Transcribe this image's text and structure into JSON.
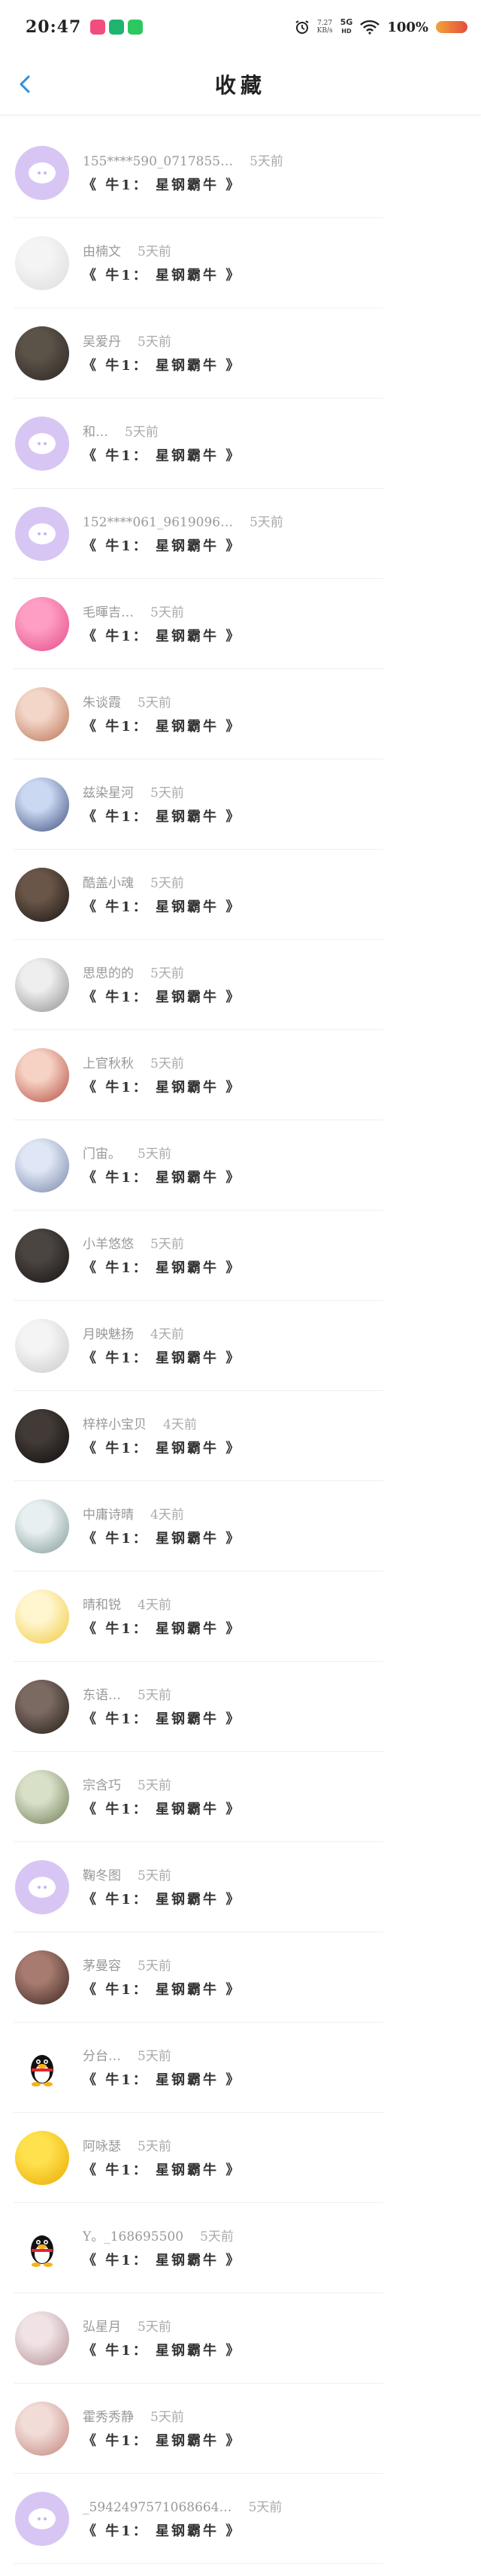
{
  "status_bar": {
    "time": "20:47",
    "net_speed_value": "7.27",
    "net_speed_unit": "KB/s",
    "signal_label": "5G",
    "signal_sub": "HD",
    "battery": "100%"
  },
  "header": {
    "title": "收藏"
  },
  "favorites": [
    {
      "name": "155****590_0717855…",
      "time": "5天前",
      "title": "《 牛1： 星钢霸牛 》",
      "avatar": "default"
    },
    {
      "name": "由楠文",
      "time": "5天前",
      "title": "《 牛1： 星钢霸牛 》",
      "avatar": "photo",
      "colors": [
        "#f4f4f4",
        "#dcdcdc"
      ]
    },
    {
      "name": "吴爱丹",
      "time": "5天前",
      "title": "《 牛1： 星钢霸牛 》",
      "avatar": "photo",
      "colors": [
        "#5b5248",
        "#2c2622"
      ]
    },
    {
      "name": "和…",
      "time": "5天前",
      "title": "《 牛1： 星钢霸牛 》",
      "avatar": "default"
    },
    {
      "name": "152****061_9619096…",
      "time": "5天前",
      "title": "《 牛1： 星钢霸牛 》",
      "avatar": "default"
    },
    {
      "name": "毛暉吉…",
      "time": "5天前",
      "title": "《 牛1： 星钢霸牛 》",
      "avatar": "photo",
      "colors": [
        "#ff9ec4",
        "#e24a88"
      ]
    },
    {
      "name": "朱谈霞",
      "time": "5天前",
      "title": "《 牛1： 星钢霸牛 》",
      "avatar": "photo",
      "colors": [
        "#f3d6c8",
        "#b8704f"
      ]
    },
    {
      "name": "兹染星河",
      "time": "5天前",
      "title": "《 牛1： 星钢霸牛 》",
      "avatar": "photo",
      "colors": [
        "#cbd8f2",
        "#3c4e7c"
      ]
    },
    {
      "name": "酷盖小魂",
      "time": "5天前",
      "title": "《 牛1： 星钢霸牛 》",
      "avatar": "photo",
      "colors": [
        "#6a5648",
        "#181412"
      ]
    },
    {
      "name": "思思的的",
      "time": "5天前",
      "title": "《 牛1： 星钢霸牛 》",
      "avatar": "photo",
      "colors": [
        "#eeeeee",
        "#8d8d8d"
      ]
    },
    {
      "name": "上官秋秋",
      "time": "5天前",
      "title": "《 牛1： 星钢霸牛 》",
      "avatar": "photo",
      "colors": [
        "#f6d2c4",
        "#b34b3e"
      ]
    },
    {
      "name": "门宙。",
      "time": "5天前",
      "title": "《 牛1： 星钢霸牛 》",
      "avatar": "photo",
      "colors": [
        "#dfe6f5",
        "#7585a8"
      ]
    },
    {
      "name": "小羊悠悠",
      "time": "5天前",
      "title": "《 牛1： 星钢霸牛 》",
      "avatar": "photo",
      "colors": [
        "#4b4542",
        "#16120f"
      ]
    },
    {
      "name": "月映魅扬",
      "time": "4天前",
      "title": "《 牛1： 星钢霸牛 》",
      "avatar": "photo",
      "colors": [
        "#f4f4f4",
        "#c9c9c9"
      ]
    },
    {
      "name": "梓梓小宝贝",
      "time": "4天前",
      "title": "《 牛1： 星钢霸牛 》",
      "avatar": "photo",
      "colors": [
        "#423a36",
        "#0f0c0b"
      ]
    },
    {
      "name": "中庸诗晴",
      "time": "4天前",
      "title": "《 牛1： 星钢霸牛 》",
      "avatar": "photo",
      "colors": [
        "#e8eff0",
        "#7d9a95"
      ]
    },
    {
      "name": "晴和锐",
      "time": "4天前",
      "title": "《 牛1： 星钢霸牛 》",
      "avatar": "photo",
      "colors": [
        "#fff6cf",
        "#f0c838"
      ]
    },
    {
      "name": "东语…",
      "time": "5天前",
      "title": "《 牛1： 星钢霸牛 》",
      "avatar": "photo",
      "colors": [
        "#7b6a62",
        "#231b18"
      ]
    },
    {
      "name": "宗含巧",
      "time": "5天前",
      "title": "《 牛1： 星钢霸牛 》",
      "avatar": "photo",
      "colors": [
        "#d9e0c8",
        "#6d7b55"
      ]
    },
    {
      "name": "鞠冬图",
      "time": "5天前",
      "title": "《 牛1： 星钢霸牛 》",
      "avatar": "default"
    },
    {
      "name": "茅曼容",
      "time": "5天前",
      "title": "《 牛1： 星钢霸牛 》",
      "avatar": "photo",
      "colors": [
        "#a77b6f",
        "#3a2520"
      ]
    },
    {
      "name": "分台…",
      "time": "5天前",
      "title": "《 牛1： 星钢霸牛 》",
      "avatar": "qq"
    },
    {
      "name": "阿咏瑟",
      "time": "5天前",
      "title": "《 牛1： 星钢霸牛 》",
      "avatar": "photo",
      "colors": [
        "#ffe14d",
        "#e8a800"
      ]
    },
    {
      "name": "Y。_168695500",
      "time": "5天前",
      "title": "《 牛1： 星钢霸牛 》",
      "avatar": "qq"
    },
    {
      "name": "弘星月",
      "time": "5天前",
      "title": "《 牛1： 星钢霸牛 》",
      "avatar": "photo",
      "colors": [
        "#f1e3e5",
        "#b08d93"
      ]
    },
    {
      "name": "霍秀秀静",
      "time": "5天前",
      "title": "《 牛1： 星钢霸牛 》",
      "avatar": "photo",
      "colors": [
        "#f2dcd7",
        "#c0837a"
      ]
    },
    {
      "name": "_5942497571068664…",
      "time": "5天前",
      "title": "《 牛1： 星钢霸牛 》",
      "avatar": "default"
    }
  ],
  "colors": {
    "accent": "#2f8fd8",
    "default_avatar_bg": "#d7c6f4",
    "divider": "#efefef"
  }
}
